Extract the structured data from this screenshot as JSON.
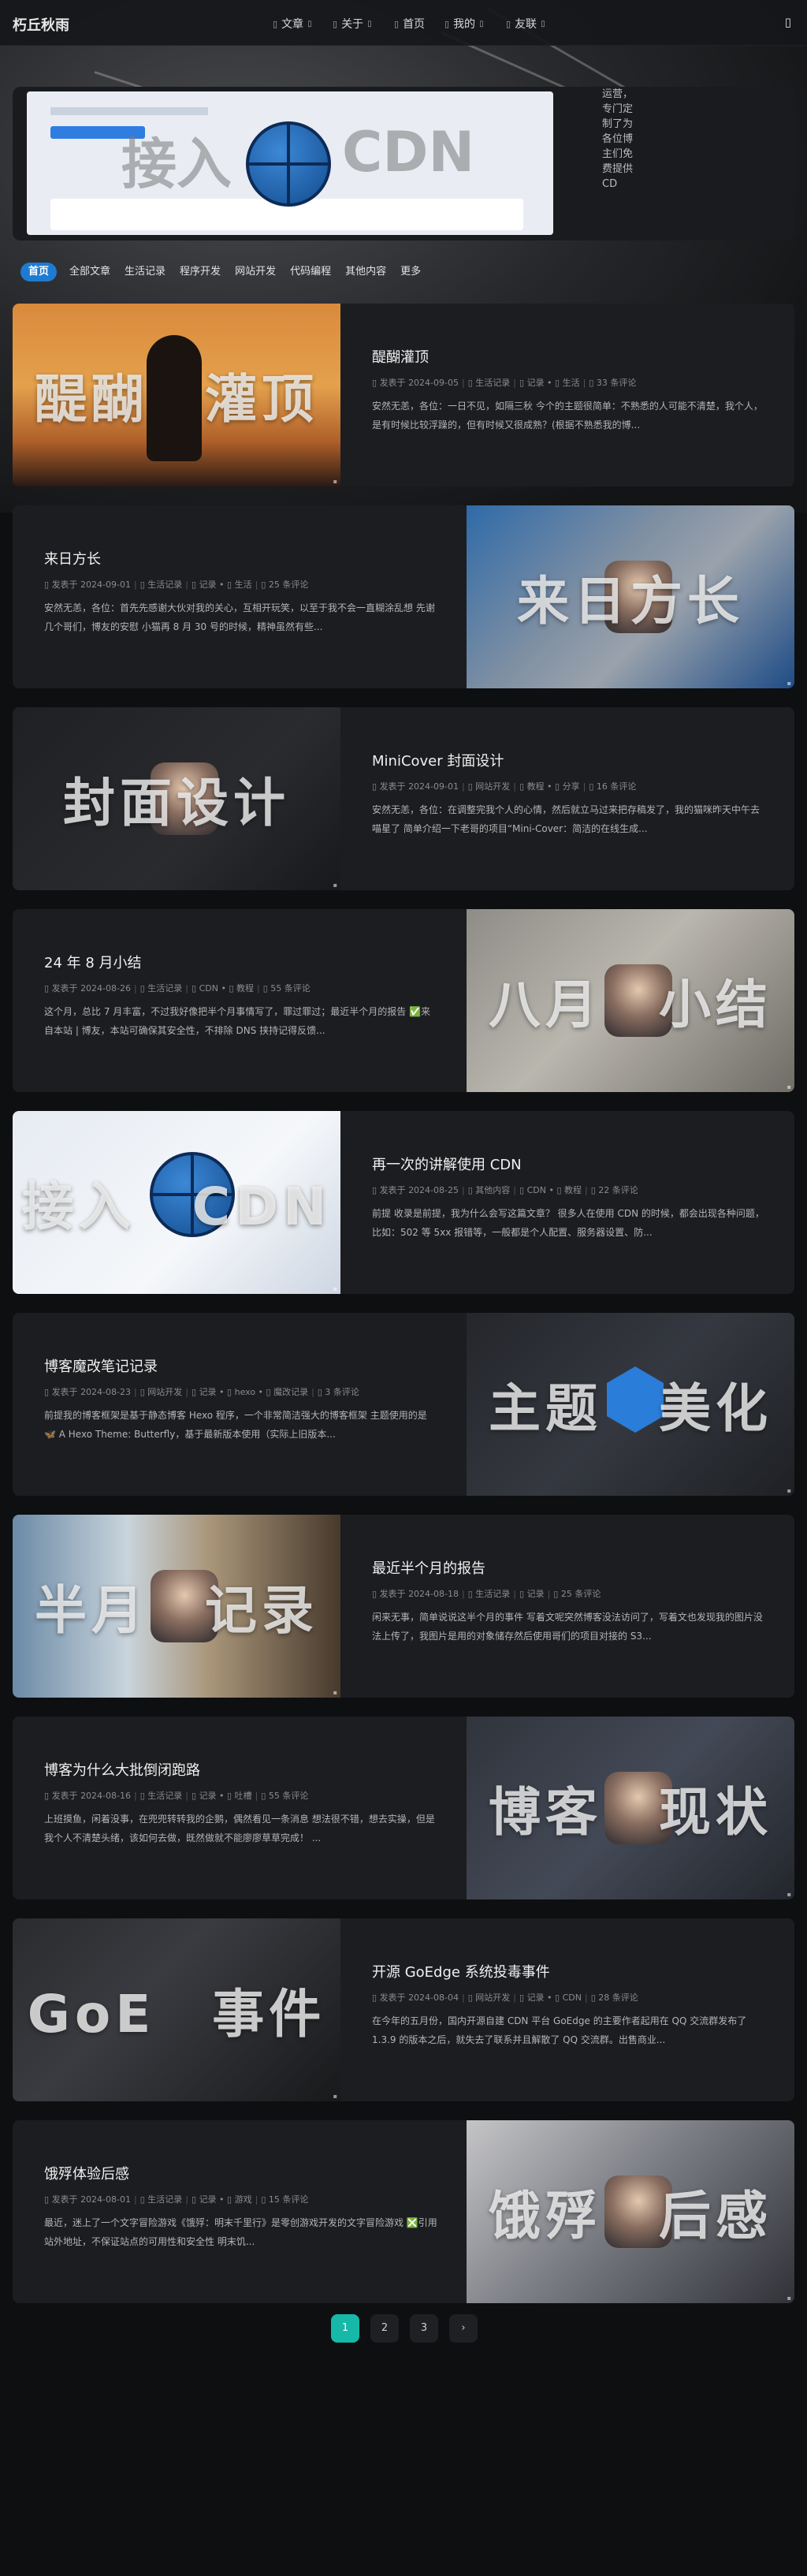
{
  "site_title": "朽丘秋雨",
  "nav": [
    {
      "label": "文章",
      "icon": "book-icon",
      "caret": true
    },
    {
      "label": "关于",
      "icon": "info-icon",
      "caret": true
    },
    {
      "label": "首页",
      "icon": "home-icon",
      "caret": false
    },
    {
      "label": "我的",
      "icon": "user-icon",
      "caret": true
    },
    {
      "label": "友联",
      "icon": "link-icon",
      "caret": true
    }
  ],
  "hero": {
    "cover_text": "接入",
    "cover_text2": "CDN",
    "side_text": "运营，专门定制了为各位博主们免费提供CD"
  },
  "categories": [
    "首页",
    "全部文章",
    "生活记录",
    "程序开发",
    "网站开发",
    "代码编程",
    "其他内容",
    "更多"
  ],
  "meta_prefix": "发表于",
  "posts": [
    {
      "title": "醍醐灌顶",
      "date": "2024-09-05",
      "cat": "生活记录",
      "tags": [
        "记录",
        "生活"
      ],
      "comments": "33 条评论",
      "excerpt": "安然无恙，各位：一日不见，如隔三秋 今个的主题很简单：不熟悉的人可能不清楚，我个人，是有时候比较浮躁的，但有时候又很成熟？(根据不熟悉我的博...",
      "cover": "醍醐　灌顶",
      "side": "left",
      "theme": "sunset"
    },
    {
      "title": "来日方长",
      "date": "2024-09-01",
      "cat": "生活记录",
      "tags": [
        "记录",
        "生活"
      ],
      "comments": "25 条评论",
      "excerpt": "安然无恙，各位：首先先感谢大伙对我的关心，互相开玩笑，以至于我不会一直糊涂乱想 先谢几个哥们，博友的安慰 小猫再 8 月 30 号的时候，精神虽然有些...",
      "cover": "来日方长",
      "side": "right",
      "theme": "cat"
    },
    {
      "title": "MiniCover 封面设计",
      "date": "2024-09-01",
      "cat": "网站开发",
      "tags": [
        "教程",
        "分享"
      ],
      "comments": "16 条评论",
      "excerpt": "安然无恙，各位：在调整完我个人的心情，然后就立马过来把存稿发了，我的猫咪昨天中午去喵星了 简单介绍一下老哥的项目“Mini-Cover：简洁的在线生成...",
      "cover": "封面设计",
      "side": "left",
      "theme": "dark"
    },
    {
      "title": "24 年 8 月小结",
      "date": "2024-08-26",
      "cat": "生活记录",
      "tags": [
        "CDN",
        "教程"
      ],
      "comments": "55 条评论",
      "excerpt": "这个月，总比 7 月丰富，不过我好像把半个月事情写了，罪过罪过；最近半个月的报告 ✅来自本站 | 博友，本站可确保其安全性，不排除 DNS 挟持记得反馈...",
      "cover": "八月　小结",
      "side": "right",
      "theme": "grey"
    },
    {
      "title": "再一次的讲解使用 CDN",
      "date": "2024-08-25",
      "cat": "其他内容",
      "tags": [
        "CDN",
        "教程"
      ],
      "comments": "22 条评论",
      "excerpt": "前提 收录是前提，我为什么会写这篇文章？ 很多人在使用 CDN 的时候，都会出现各种问题，比如：502 等 5xx 报错等，一般都是个人配置、服务器设置、防...",
      "cover": "接入　CDN",
      "side": "left",
      "theme": "light"
    },
    {
      "title": "博客魔改笔记记录",
      "date": "2024-08-23",
      "cat": "网站开发",
      "tags": [
        "记录",
        "hexo",
        "魔改记录"
      ],
      "comments": "3 条评论",
      "excerpt": "前提我的博客框架是基于静态博客 Hexo 程序，一个非常简洁强大的博客框架 主题使用的是 🦋 A Hexo Theme: Butterfly，基于最新版本使用（实际上旧版本...",
      "cover": "主题　美化",
      "side": "right",
      "theme": "ui"
    },
    {
      "title": "最近半个月的报告",
      "date": "2024-08-18",
      "cat": "生活记录",
      "tags": [
        "记录"
      ],
      "comments": "25 条评论",
      "excerpt": "闲来无事，简单说说这半个月的事件 写着文呢突然博客没法访问了，写着文也发现我的图片没法上传了，我图片是用的对象储存然后使用哥们的项目对接的 S3...",
      "cover": "半月　记录",
      "side": "left",
      "theme": "can"
    },
    {
      "title": "博客为什么大批倒闭跑路",
      "date": "2024-08-16",
      "cat": "生活记录",
      "tags": [
        "记录",
        "吐槽"
      ],
      "comments": "55 条评论",
      "excerpt": "上班摸鱼，闲着没事，在兜兜转转我的企鹅，偶然看见一条消息 想法很不错，想去实操，但是我个人不清楚头绪，该如何去做，既然做就不能廖廖草草完成！ ...",
      "cover": "博客　现状",
      "side": "right",
      "theme": "ui2"
    },
    {
      "title": "开源 GoEdge 系统投毒事件",
      "date": "2024-08-04",
      "cat": "网站开发",
      "tags": [
        "记录",
        "CDN"
      ],
      "comments": "28 条评论",
      "excerpt": "在今年的五月份，国内开源自建 CDN 平台 GoEdge 的主要作者起用在 QQ 交流群发布了 1.3.9 的版本之后，就失去了联系并且解散了 QQ 交流群。出售商业...",
      "cover": "GoE　事件",
      "side": "left",
      "theme": "goedge"
    },
    {
      "title": "饿殍体验后感",
      "date": "2024-08-01",
      "cat": "生活记录",
      "tags": [
        "记录",
        "游戏"
      ],
      "comments": "15 条评论",
      "excerpt": "最近，迷上了一个文字冒险游戏《饿殍：明末千里行》是零创游戏开发的文字冒险游戏 ❎引用站外地址，不保证站点的可用性和安全性 明末饥...",
      "cover": "饿殍　后感",
      "side": "right",
      "theme": "battle"
    }
  ],
  "pagination": [
    "1",
    "2",
    "3",
    "›"
  ]
}
